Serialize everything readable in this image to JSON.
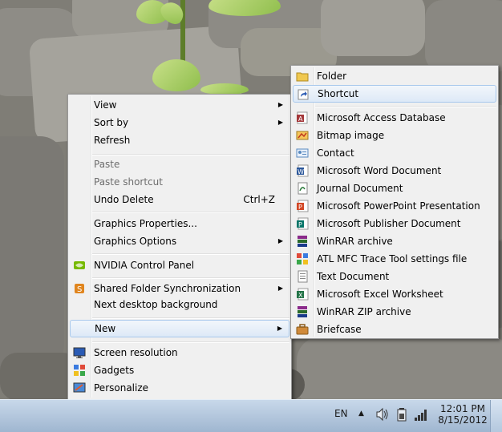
{
  "context_menu": {
    "items": [
      {
        "label": "View",
        "submenu": true
      },
      {
        "label": "Sort by",
        "submenu": true
      },
      {
        "label": "Refresh"
      },
      {
        "label": "Paste",
        "disabled": true
      },
      {
        "label": "Paste shortcut",
        "disabled": true
      },
      {
        "label": "Undo Delete",
        "accel": "Ctrl+Z"
      },
      {
        "label": "Graphics Properties..."
      },
      {
        "label": "Graphics Options",
        "submenu": true
      },
      {
        "label": "NVIDIA Control Panel",
        "icon": "nvidia-icon"
      },
      {
        "label": "Shared Folder Synchronization",
        "icon": "sync-icon",
        "submenu": true
      },
      {
        "label": "Next desktop background"
      },
      {
        "label": "New",
        "submenu": true,
        "highlighted": true
      },
      {
        "label": "Screen resolution",
        "icon": "monitor-icon"
      },
      {
        "label": "Gadgets",
        "icon": "gadgets-icon"
      },
      {
        "label": "Personalize",
        "icon": "personalize-icon"
      }
    ]
  },
  "new_submenu": {
    "items": [
      {
        "label": "Folder",
        "icon": "folder-icon"
      },
      {
        "label": "Shortcut",
        "icon": "shortcut-icon",
        "highlighted": true
      },
      {
        "label": "Microsoft Access Database",
        "icon": "access-icon"
      },
      {
        "label": "Bitmap image",
        "icon": "bitmap-icon"
      },
      {
        "label": "Contact",
        "icon": "contact-icon"
      },
      {
        "label": "Microsoft Word Document",
        "icon": "word-icon"
      },
      {
        "label": "Journal Document",
        "icon": "journal-icon"
      },
      {
        "label": "Microsoft PowerPoint Presentation",
        "icon": "powerpoint-icon"
      },
      {
        "label": "Microsoft Publisher Document",
        "icon": "publisher-icon"
      },
      {
        "label": "WinRAR archive",
        "icon": "winrar-icon"
      },
      {
        "label": "ATL MFC Trace Tool settings file",
        "icon": "atl-trace-icon"
      },
      {
        "label": "Text Document",
        "icon": "text-document-icon"
      },
      {
        "label": "Microsoft Excel Worksheet",
        "icon": "excel-icon"
      },
      {
        "label": "WinRAR ZIP archive",
        "icon": "winrar-zip-icon"
      },
      {
        "label": "Briefcase",
        "icon": "briefcase-icon"
      }
    ]
  },
  "taskbar": {
    "language": "EN",
    "time": "12:01 PM",
    "date": "8/15/2012"
  }
}
